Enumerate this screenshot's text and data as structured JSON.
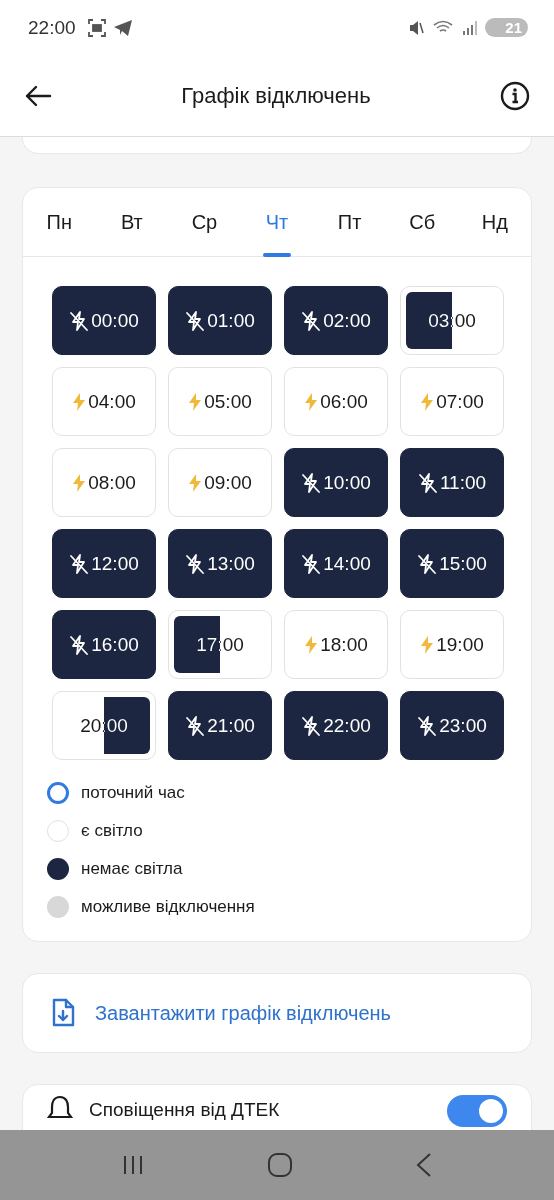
{
  "status_bar": {
    "time": "22:00",
    "battery": "21"
  },
  "app_bar": {
    "title": "Графік відключень"
  },
  "tabs": [
    {
      "label": "Пн",
      "selected": false
    },
    {
      "label": "Вт",
      "selected": false
    },
    {
      "label": "Ср",
      "selected": false
    },
    {
      "label": "Чт",
      "selected": true
    },
    {
      "label": "Пт",
      "selected": false
    },
    {
      "label": "Сб",
      "selected": false
    },
    {
      "label": "Нд",
      "selected": false
    }
  ],
  "hours": [
    {
      "time": "00:00",
      "kind": "off"
    },
    {
      "time": "01:00",
      "kind": "off"
    },
    {
      "time": "02:00",
      "kind": "off"
    },
    {
      "time": "03:00",
      "kind": "off_first_half"
    },
    {
      "time": "04:00",
      "kind": "on"
    },
    {
      "time": "05:00",
      "kind": "on"
    },
    {
      "time": "06:00",
      "kind": "on"
    },
    {
      "time": "07:00",
      "kind": "on"
    },
    {
      "time": "08:00",
      "kind": "on"
    },
    {
      "time": "09:00",
      "kind": "on"
    },
    {
      "time": "10:00",
      "kind": "off"
    },
    {
      "time": "11:00",
      "kind": "off"
    },
    {
      "time": "12:00",
      "kind": "off"
    },
    {
      "time": "13:00",
      "kind": "off"
    },
    {
      "time": "14:00",
      "kind": "off"
    },
    {
      "time": "15:00",
      "kind": "off"
    },
    {
      "time": "16:00",
      "kind": "off"
    },
    {
      "time": "17:00",
      "kind": "off_first_half"
    },
    {
      "time": "18:00",
      "kind": "on"
    },
    {
      "time": "19:00",
      "kind": "on"
    },
    {
      "time": "20:00",
      "kind": "off_second_half"
    },
    {
      "time": "21:00",
      "kind": "off"
    },
    {
      "time": "22:00",
      "kind": "off"
    },
    {
      "time": "23:00",
      "kind": "off"
    }
  ],
  "legend": [
    {
      "label": "поточний час",
      "kind": "current"
    },
    {
      "label": "є світло",
      "kind": "on"
    },
    {
      "label": "немає світла",
      "kind": "off"
    },
    {
      "label": "можливе відключення",
      "kind": "maybe"
    }
  ],
  "download": {
    "label": "Завантажити графік відключень"
  },
  "notifications": {
    "label": "Сповіщення від ДТЕК",
    "on": true
  }
}
